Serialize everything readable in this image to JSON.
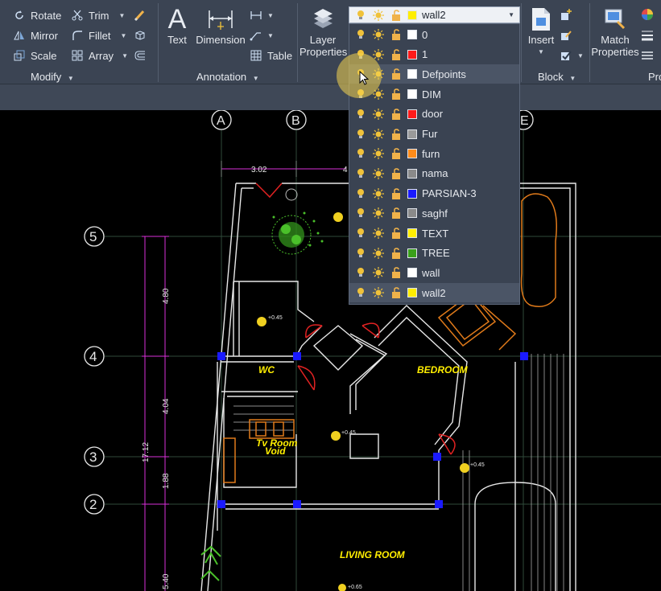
{
  "modify": {
    "rotate": "Rotate",
    "trim": "Trim",
    "mirror": "Mirror",
    "fillet": "Fillet",
    "scale": "Scale",
    "array": "Array",
    "title": "Modify"
  },
  "annotation": {
    "text": "Text",
    "dimension": "Dimension",
    "table": "Table",
    "title": "Annotation"
  },
  "layers": {
    "layer_properties_1": "Layer",
    "layer_properties_2": "Properties",
    "current": "wall2",
    "current_color": "#ffee00",
    "items": [
      {
        "name": "0",
        "color": "#ffffff"
      },
      {
        "name": "1",
        "color": "#ff1a1a"
      },
      {
        "name": "Defpoints",
        "color": "#ffffff"
      },
      {
        "name": "DIM",
        "color": "#ffffff"
      },
      {
        "name": "door",
        "color": "#ff1a1a"
      },
      {
        "name": "Fur",
        "color": "#9a9a9a"
      },
      {
        "name": "furn",
        "color": "#ff8c1a"
      },
      {
        "name": "nama",
        "color": "#8a8a8a"
      },
      {
        "name": "PARSIAN-3",
        "color": "#1a1aff"
      },
      {
        "name": "saghf",
        "color": "#8a8a8a"
      },
      {
        "name": "TEXT",
        "color": "#ffee00"
      },
      {
        "name": "TREE",
        "color": "#3aa01a"
      },
      {
        "name": "wall",
        "color": "#ffffff"
      },
      {
        "name": "wall2",
        "color": "#ffee00"
      }
    ]
  },
  "block": {
    "insert": "Insert",
    "title": "Block"
  },
  "properties": {
    "match_1": "Match",
    "match_2": "Properties",
    "title_partial": "Pro"
  },
  "drawing": {
    "grid_letters": [
      "A",
      "B",
      "E"
    ],
    "grid_numbers": [
      "5",
      "4",
      "3",
      "2"
    ],
    "dims": [
      "3.02",
      "4",
      "4.80",
      "4.04",
      "1.88",
      "17.12",
      "5.40"
    ],
    "levels": [
      "+0.45",
      "+0.45",
      "+0.45",
      "+0.65"
    ],
    "rooms": {
      "wc": "WC",
      "bedroom": "BEDROOM",
      "tv_room": "Tv Room",
      "void": "Void",
      "living_room": "LIVING ROOM"
    }
  }
}
